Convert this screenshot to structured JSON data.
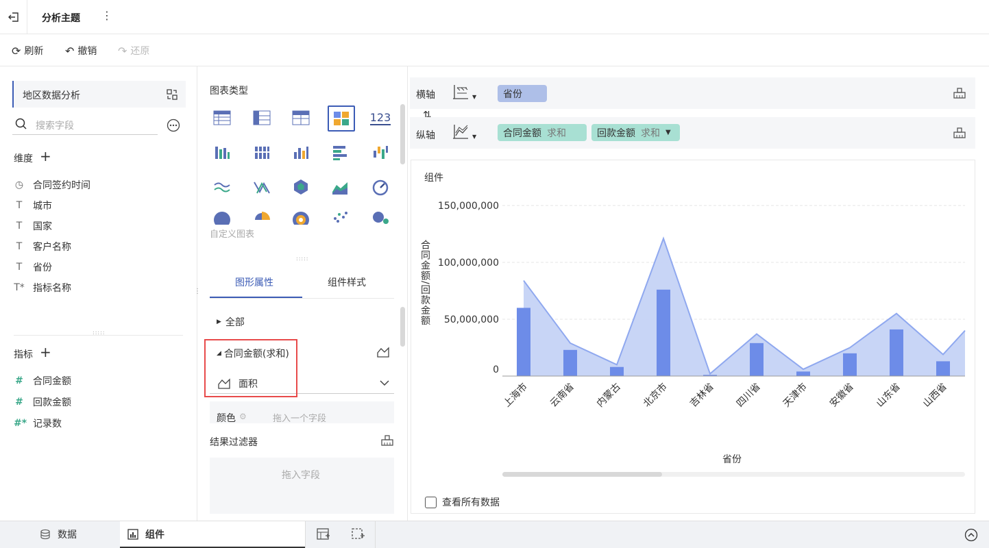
{
  "header": {
    "title": "分析主题"
  },
  "toolbar": {
    "refresh": "刷新",
    "undo": "撤销",
    "redo": "还原"
  },
  "left": {
    "dataset": "地区数据分析",
    "search_placeholder": "搜索字段",
    "dimensions_title": "维度",
    "dimensions": [
      {
        "icon": "clock-icon",
        "label": "合同签约时间"
      },
      {
        "icon": "text-icon",
        "label": "城市"
      },
      {
        "icon": "text-icon",
        "label": "国家"
      },
      {
        "icon": "text-icon",
        "label": "客户名称"
      },
      {
        "icon": "text-icon",
        "label": "省份"
      },
      {
        "icon": "text-calc-icon",
        "label": "指标名称"
      }
    ],
    "measures_title": "指标",
    "measures": [
      {
        "icon": "hash-icon",
        "label": "合同金额"
      },
      {
        "icon": "hash-icon",
        "label": "回款金额"
      },
      {
        "icon": "hash-calc-icon",
        "label": "记录数"
      }
    ]
  },
  "middle": {
    "chart_type_title": "图表类型",
    "custom_chart": "自定义图表",
    "tabs": [
      "图形属性",
      "组件样式"
    ],
    "all": "全部",
    "measure_item": "合同金额(求和)",
    "shape": "面积",
    "color_label": "颜色",
    "color_drop": "拖入一个字段",
    "filter_title": "结果过滤器",
    "filter_drop": "拖入字段"
  },
  "axes": {
    "x_label": "横轴",
    "y_label": "纵轴",
    "x_fields": [
      {
        "name": "省份"
      }
    ],
    "y_fields": [
      {
        "name": "合同金额",
        "agg": "求和"
      },
      {
        "name": "回款金额",
        "agg": "求和"
      }
    ]
  },
  "chart": {
    "component_label": "组件",
    "show_all": "查看所有数据",
    "colors": {
      "bar": "#6d8ce8",
      "area": "#c5d3f5",
      "line": "#8fa8ef"
    }
  },
  "chart_data": {
    "type": "bar",
    "categories": [
      "上海市",
      "云南省",
      "内蒙古",
      "北京市",
      "吉林省",
      "四川省",
      "天津市",
      "安徽省",
      "山东省",
      "山西省"
    ],
    "series": [
      {
        "name": "合同金额",
        "type": "area",
        "values": [
          84000000,
          29000000,
          10000000,
          121000000,
          2000000,
          37000000,
          6000000,
          25000000,
          55000000,
          19000000
        ]
      },
      {
        "name": "回款金额",
        "type": "bar",
        "values": [
          60000000,
          23000000,
          8000000,
          76000000,
          1000000,
          29000000,
          4000000,
          20000000,
          41000000,
          13000000
        ]
      }
    ],
    "xlabel": "省份",
    "ylabel": "合同金额/回款金额",
    "y_ticks": [
      "0",
      "50,000,000",
      "100,000,000",
      "150,000,000"
    ],
    "ylim": [
      0,
      150000000
    ]
  },
  "bottom": {
    "tabs": [
      "数据",
      "组件"
    ]
  }
}
